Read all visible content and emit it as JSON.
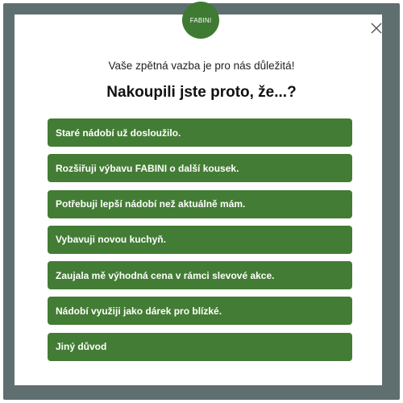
{
  "popup": {
    "logo_text": "FABINI",
    "close_icon": "close-icon",
    "subtitle": "Vaše zpětná vazba je pro nás důležitá!",
    "title": "Nakoupili jste proto, že...?",
    "options": [
      "Staré nádobí už dosloužilo.",
      "Rozšiřuji výbavu FABINI o další kousek.",
      "Potřebuji lepší nádobí než aktuálně mám.",
      "Vybavuji novou kuchyň.",
      "Zaujala mě výhodná cena v rámci slevové akce.",
      "Nádobí využiji jako dárek pro blízké.",
      "Jiný důvod"
    ]
  },
  "colors": {
    "frame": "#5f6f70",
    "brand_green": "#437c34",
    "logo_green": "#3f7a33",
    "text_white": "#ffffff"
  }
}
